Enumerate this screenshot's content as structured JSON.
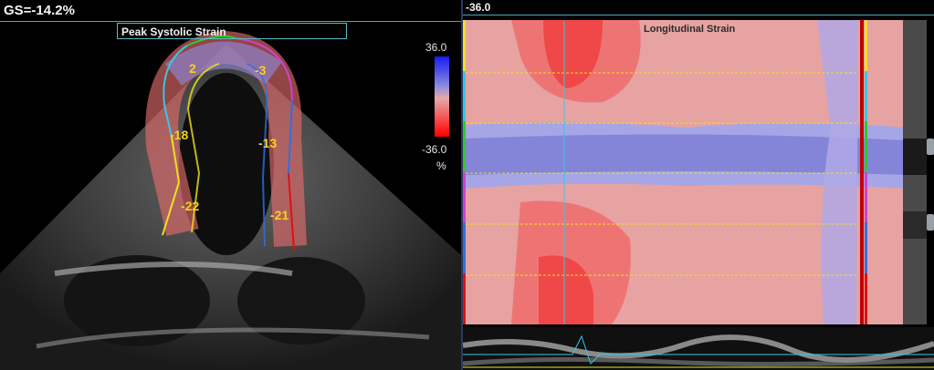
{
  "left_panel": {
    "global_strain": "GS=-14.2%",
    "view_label": "Peak Systolic Strain",
    "scale": {
      "max": "36.0",
      "min": "-36.0",
      "unit": "%"
    },
    "segments": [
      {
        "name": "basal-inferoseptal",
        "value": "-22",
        "color": "#f0e020"
      },
      {
        "name": "mid-inferoseptal",
        "value": "-18",
        "color": "#38c8e0"
      },
      {
        "name": "apical-septal",
        "value": "2",
        "color": "#30c830"
      },
      {
        "name": "apical-lateral",
        "value": "-3",
        "color": "#d040d0"
      },
      {
        "name": "mid-anterolateral",
        "value": "-13",
        "color": "#2f6fe0"
      },
      {
        "name": "basal-anterolateral",
        "value": "-21",
        "color": "#e01010"
      }
    ]
  },
  "right_panel": {
    "top_value": "-36.0",
    "heatmap_title": "Longitudinal Strain",
    "segment_bar_colors": [
      "#f0e020",
      "#38c8e0",
      "#30c830",
      "#d040d0",
      "#2f6fe0",
      "#e01010"
    ]
  }
}
